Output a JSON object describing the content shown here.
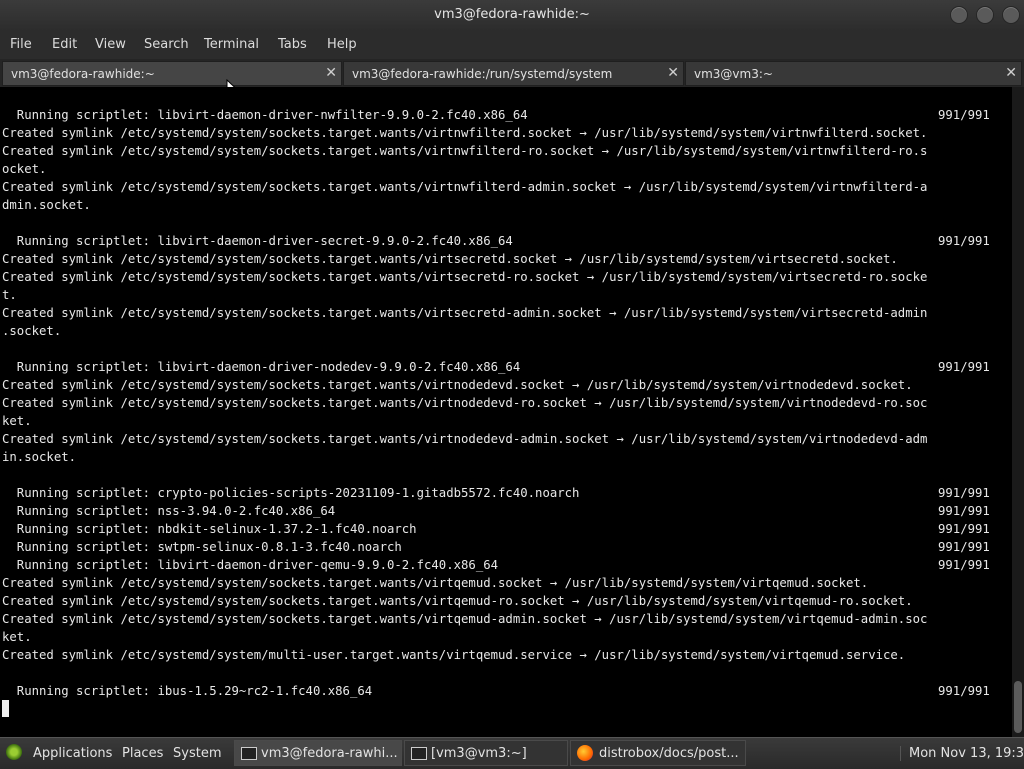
{
  "window": {
    "title": "vm3@fedora-rawhide:~"
  },
  "menubar": [
    "File",
    "Edit",
    "View",
    "Search",
    "Terminal",
    "Tabs",
    "Help"
  ],
  "tabs": [
    {
      "label": "vm3@fedora-rawhide:~",
      "active": true
    },
    {
      "label": "vm3@fedora-rawhide:/run/systemd/system",
      "active": false
    },
    {
      "label": "vm3@vm3:~",
      "active": false
    }
  ],
  "terminal": {
    "lines": [
      "  Running scriptlet: libvirt-daemon-driver-nwfilter-9.9.0-2.fc40.x86_64",
      "Created symlink /etc/systemd/system/sockets.target.wants/virtnwfilterd.socket → /usr/lib/systemd/system/virtnwfilterd.socket.",
      "Created symlink /etc/systemd/system/sockets.target.wants/virtnwfilterd-ro.socket → /usr/lib/systemd/system/virtnwfilterd-ro.s",
      "ocket.",
      "Created symlink /etc/systemd/system/sockets.target.wants/virtnwfilterd-admin.socket → /usr/lib/systemd/system/virtnwfilterd-a",
      "dmin.socket.",
      "",
      "  Running scriptlet: libvirt-daemon-driver-secret-9.9.0-2.fc40.x86_64",
      "Created symlink /etc/systemd/system/sockets.target.wants/virtsecretd.socket → /usr/lib/systemd/system/virtsecretd.socket.",
      "Created symlink /etc/systemd/system/sockets.target.wants/virtsecretd-ro.socket → /usr/lib/systemd/system/virtsecretd-ro.socke",
      "t.",
      "Created symlink /etc/systemd/system/sockets.target.wants/virtsecretd-admin.socket → /usr/lib/systemd/system/virtsecretd-admin",
      ".socket.",
      "",
      "  Running scriptlet: libvirt-daemon-driver-nodedev-9.9.0-2.fc40.x86_64",
      "Created symlink /etc/systemd/system/sockets.target.wants/virtnodedevd.socket → /usr/lib/systemd/system/virtnodedevd.socket.",
      "Created symlink /etc/systemd/system/sockets.target.wants/virtnodedevd-ro.socket → /usr/lib/systemd/system/virtnodedevd-ro.soc",
      "ket.",
      "Created symlink /etc/systemd/system/sockets.target.wants/virtnodedevd-admin.socket → /usr/lib/systemd/system/virtnodedevd-adm",
      "in.socket.",
      "",
      "  Running scriptlet: crypto-policies-scripts-20231109-1.gitadb5572.fc40.noarch",
      "  Running scriptlet: nss-3.94.0-2.fc40.x86_64",
      "  Running scriptlet: nbdkit-selinux-1.37.2-1.fc40.noarch",
      "  Running scriptlet: swtpm-selinux-0.8.1-3.fc40.noarch",
      "  Running scriptlet: libvirt-daemon-driver-qemu-9.9.0-2.fc40.x86_64",
      "Created symlink /etc/systemd/system/sockets.target.wants/virtqemud.socket → /usr/lib/systemd/system/virtqemud.socket.",
      "Created symlink /etc/systemd/system/sockets.target.wants/virtqemud-ro.socket → /usr/lib/systemd/system/virtqemud-ro.socket.",
      "Created symlink /etc/systemd/system/sockets.target.wants/virtqemud-admin.socket → /usr/lib/systemd/system/virtqemud-admin.soc",
      "ket.",
      "Created symlink /etc/systemd/system/multi-user.target.wants/virtqemud.service → /usr/lib/systemd/system/virtqemud.service.",
      "",
      "  Running scriptlet: ibus-1.5.29~rc2-1.fc40.x86_64"
    ],
    "progress": "991/991"
  },
  "taskbar": {
    "applications": "Applications",
    "places": "Places",
    "system": "System",
    "tasks": [
      {
        "label": "vm3@fedora-rawhi...",
        "icon": "terminal-icon",
        "active": true
      },
      {
        "label": "[vm3@vm3:~]",
        "icon": "terminal-icon",
        "active": false
      },
      {
        "label": "distrobox/docs/post...",
        "icon": "firefox-icon",
        "active": false
      }
    ],
    "clock": "Mon Nov 13, 19:34"
  }
}
